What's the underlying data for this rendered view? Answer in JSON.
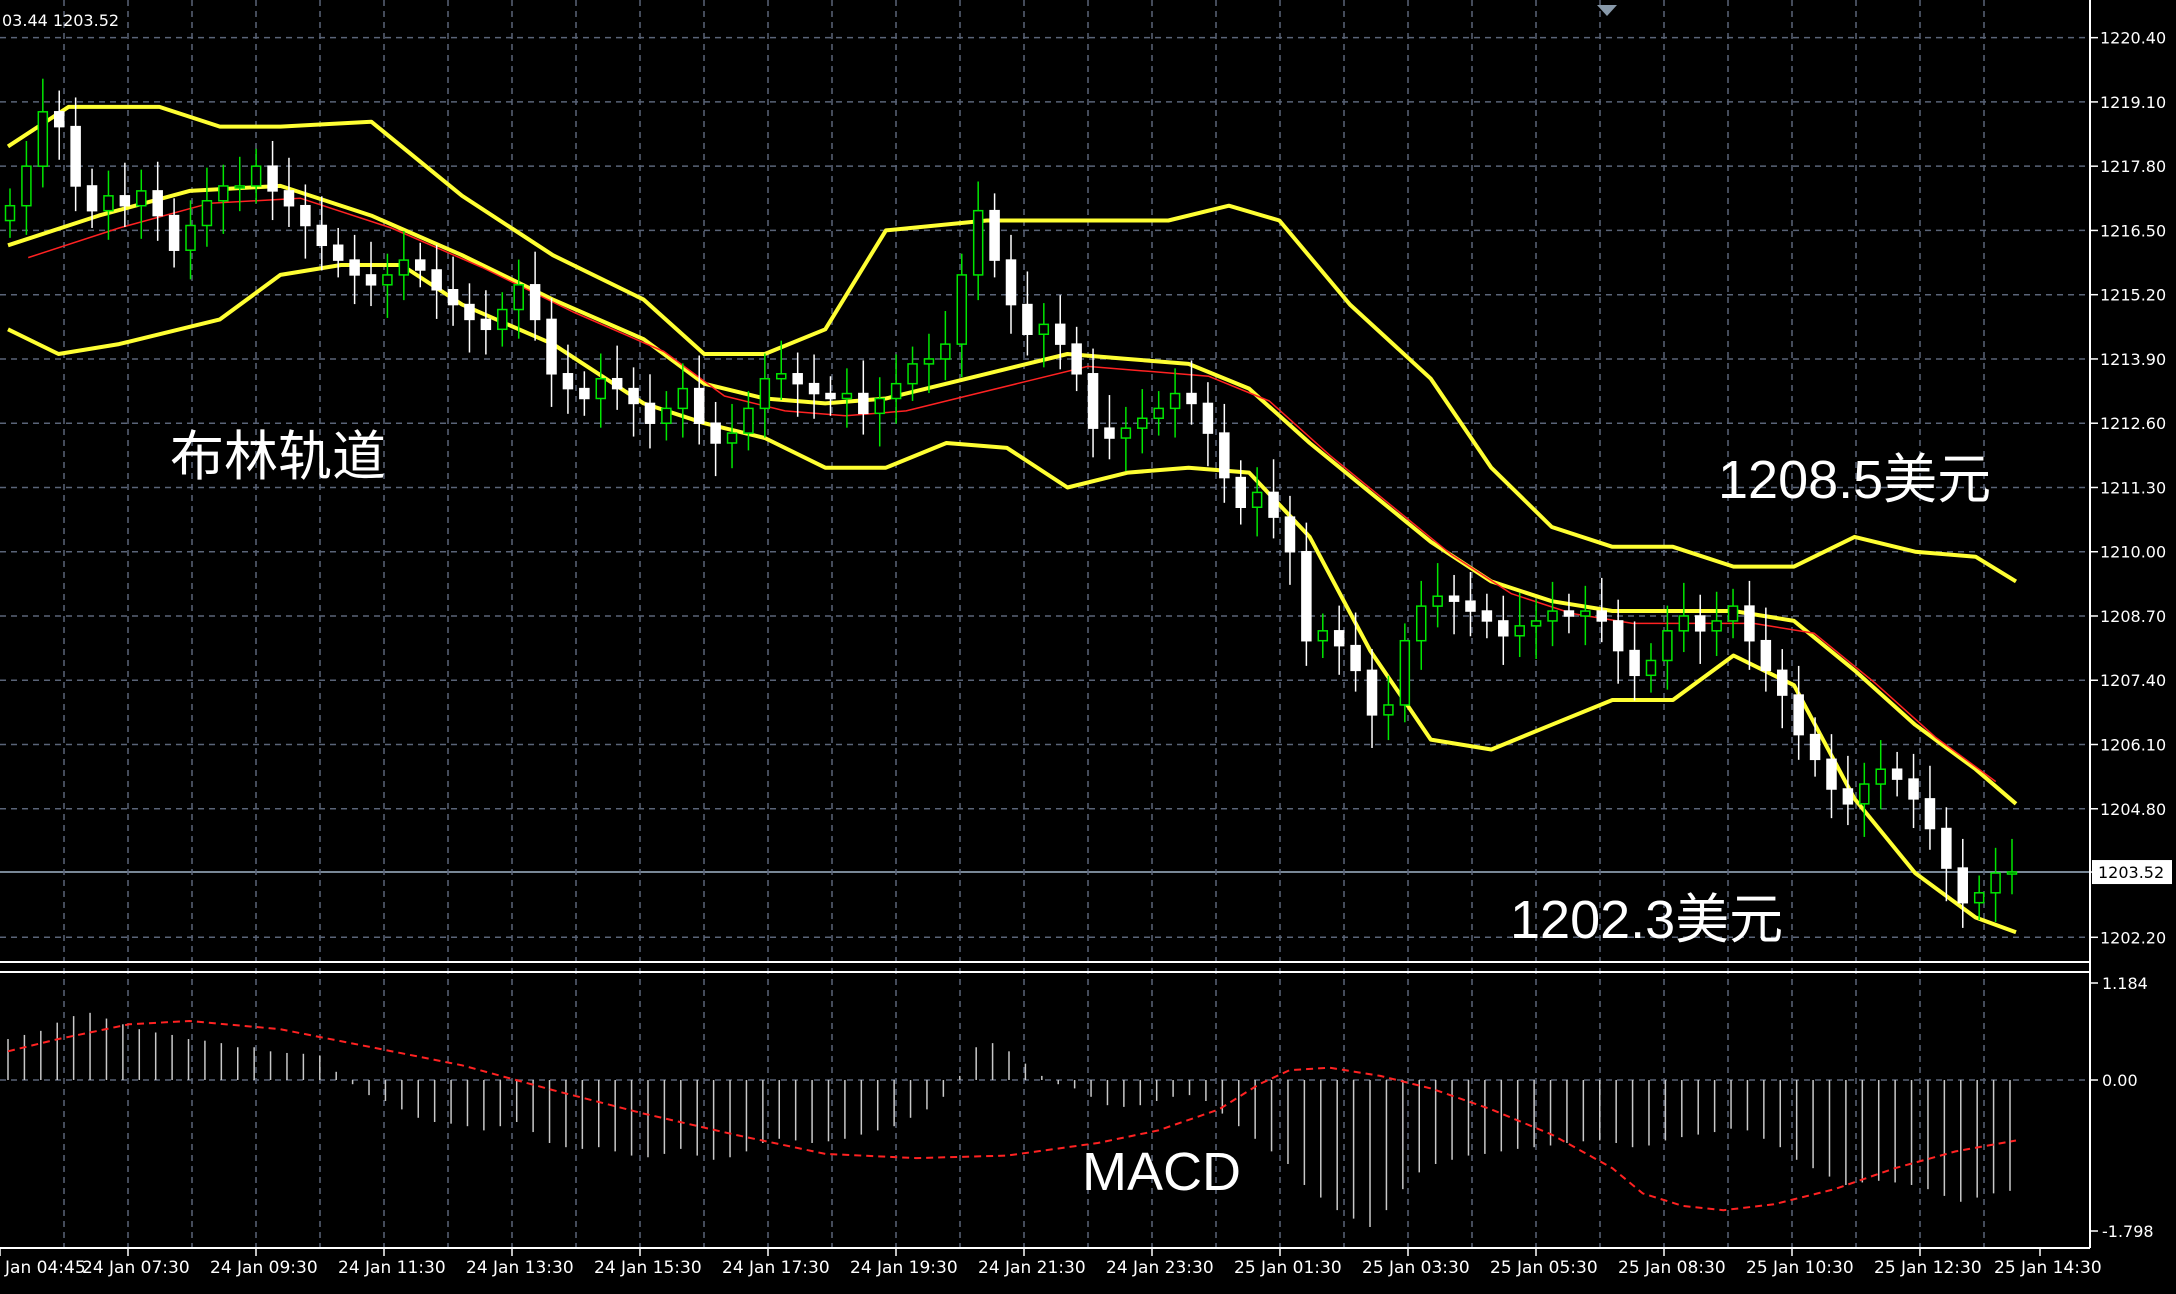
{
  "header": {
    "ohlc_text": "03.44 1203.52"
  },
  "annotations": {
    "bollinger_label": "布林轨道",
    "upper_price_label": "1208.5美元",
    "lower_price_label": "1202.3美元",
    "macd_label": "MACD"
  },
  "colors": {
    "background": "#000000",
    "grid": "#5a6478",
    "axis": "#ffffff",
    "bull_candle": "#00e600",
    "bear_candle": "#ffffff",
    "bollinger": "#ffff33",
    "moving_average": "#ff2222",
    "macd_histogram": "#c8c8c8",
    "macd_signal": "#ff2222",
    "current_price_line": "#a0b4c8"
  },
  "chart_data": [
    {
      "type": "candlestick",
      "symbol_panel": "price",
      "ylim": [
        1201.7,
        1221.0
      ],
      "y_ticks": [
        "1220.40",
        "1219.10",
        "1217.80",
        "1216.50",
        "1215.20",
        "1213.90",
        "1212.60",
        "1211.30",
        "1210.00",
        "1208.70",
        "1207.40",
        "1206.10",
        "1204.80",
        "1203.52",
        "1202.20"
      ],
      "x_ticks": [
        "24 Jan 04:45",
        "24 Jan 07:30",
        "24 Jan 09:30",
        "24 Jan 11:30",
        "24 Jan 13:30",
        "24 Jan 15:30",
        "24 Jan 17:30",
        "24 Jan 19:30",
        "24 Jan 21:30",
        "24 Jan 23:30",
        "25 Jan 01:30",
        "25 Jan 03:30",
        "25 Jan 05:30",
        "25 Jan 08:30",
        "25 Jan 10:30",
        "25 Jan 12:30",
        "25 Jan 14:30"
      ],
      "current_price": 1203.52,
      "closes": [
        1217.0,
        1217.8,
        1218.9,
        1218.6,
        1217.4,
        1216.9,
        1217.2,
        1217.0,
        1217.3,
        1216.8,
        1216.1,
        1216.6,
        1217.1,
        1217.4,
        1217.4,
        1217.8,
        1217.3,
        1217.0,
        1216.6,
        1216.2,
        1215.9,
        1215.6,
        1215.4,
        1215.6,
        1215.9,
        1215.7,
        1215.3,
        1215.0,
        1214.7,
        1214.5,
        1214.9,
        1215.4,
        1214.7,
        1213.6,
        1213.3,
        1213.1,
        1213.5,
        1213.3,
        1213.0,
        1212.6,
        1212.9,
        1213.3,
        1212.6,
        1212.2,
        1212.4,
        1212.9,
        1213.5,
        1213.6,
        1213.4,
        1213.2,
        1213.1,
        1213.2,
        1212.8,
        1213.1,
        1213.4,
        1213.8,
        1213.9,
        1214.2,
        1215.6,
        1216.9,
        1215.9,
        1215.0,
        1214.4,
        1214.6,
        1214.2,
        1213.6,
        1212.5,
        1212.3,
        1212.5,
        1212.7,
        1212.9,
        1213.2,
        1213.0,
        1212.4,
        1211.5,
        1210.9,
        1211.2,
        1210.7,
        1210.0,
        1208.2,
        1208.4,
        1208.1,
        1207.6,
        1206.7,
        1206.9,
        1208.2,
        1208.9,
        1209.1,
        1209.0,
        1208.8,
        1208.6,
        1208.3,
        1208.5,
        1208.6,
        1208.8,
        1208.7,
        1208.8,
        1208.6,
        1208.0,
        1207.5,
        1207.8,
        1208.4,
        1208.7,
        1208.4,
        1208.6,
        1208.9,
        1208.2,
        1207.6,
        1207.1,
        1206.3,
        1205.8,
        1205.2,
        1204.9,
        1205.3,
        1205.6,
        1205.4,
        1205.0,
        1204.4,
        1203.6,
        1202.9,
        1203.1,
        1203.5,
        1203.52
      ],
      "bollinger_upper": [
        [
          0,
          1218.2
        ],
        [
          6,
          1219.0
        ],
        [
          15,
          1219.0
        ],
        [
          21,
          1218.6
        ],
        [
          27,
          1218.6
        ],
        [
          36,
          1218.7
        ],
        [
          45,
          1217.2
        ],
        [
          54,
          1216.0
        ],
        [
          63,
          1215.1
        ],
        [
          69,
          1214.0
        ],
        [
          75,
          1214.0
        ],
        [
          81,
          1214.5
        ],
        [
          87,
          1216.5
        ],
        [
          97,
          1216.7
        ],
        [
          115,
          1216.7
        ],
        [
          121,
          1217.0
        ],
        [
          126,
          1216.7
        ],
        [
          133,
          1215.0
        ],
        [
          141,
          1213.5
        ],
        [
          147,
          1211.7
        ],
        [
          153,
          1210.5
        ],
        [
          159,
          1210.1
        ],
        [
          165,
          1210.1
        ],
        [
          171,
          1209.7
        ],
        [
          177,
          1209.7
        ],
        [
          183,
          1210.3
        ],
        [
          189,
          1210.0
        ],
        [
          195,
          1209.9
        ],
        [
          199,
          1209.4
        ]
      ],
      "bollinger_lower": [
        [
          0,
          1214.5
        ],
        [
          5,
          1214.0
        ],
        [
          11,
          1214.2
        ],
        [
          21,
          1214.7
        ],
        [
          27,
          1215.6
        ],
        [
          33,
          1215.8
        ],
        [
          39,
          1215.8
        ],
        [
          45,
          1215.0
        ],
        [
          54,
          1214.2
        ],
        [
          63,
          1213.0
        ],
        [
          69,
          1212.6
        ],
        [
          75,
          1212.3
        ],
        [
          81,
          1211.7
        ],
        [
          87,
          1211.7
        ],
        [
          93,
          1212.2
        ],
        [
          99,
          1212.1
        ],
        [
          105,
          1211.3
        ],
        [
          111,
          1211.6
        ],
        [
          117,
          1211.7
        ],
        [
          123,
          1211.6
        ],
        [
          129,
          1210.3
        ],
        [
          135,
          1208.0
        ],
        [
          141,
          1206.2
        ],
        [
          147,
          1206.0
        ],
        [
          153,
          1206.5
        ],
        [
          159,
          1207.0
        ],
        [
          165,
          1207.0
        ],
        [
          171,
          1207.9
        ],
        [
          177,
          1207.3
        ],
        [
          183,
          1205.0
        ],
        [
          189,
          1203.5
        ],
        [
          195,
          1202.6
        ],
        [
          199,
          1202.3
        ]
      ],
      "bollinger_middle": [
        [
          0,
          1216.2
        ],
        [
          9,
          1216.8
        ],
        [
          18,
          1217.3
        ],
        [
          27,
          1217.4
        ],
        [
          36,
          1216.8
        ],
        [
          45,
          1216.0
        ],
        [
          54,
          1215.1
        ],
        [
          63,
          1214.3
        ],
        [
          69,
          1213.4
        ],
        [
          75,
          1213.1
        ],
        [
          81,
          1213.0
        ],
        [
          87,
          1213.1
        ],
        [
          93,
          1213.4
        ],
        [
          99,
          1213.7
        ],
        [
          105,
          1214.0
        ],
        [
          111,
          1213.9
        ],
        [
          117,
          1213.8
        ],
        [
          123,
          1213.3
        ],
        [
          129,
          1212.2
        ],
        [
          135,
          1211.2
        ],
        [
          141,
          1210.2
        ],
        [
          147,
          1209.4
        ],
        [
          153,
          1209.0
        ],
        [
          159,
          1208.8
        ],
        [
          165,
          1208.8
        ],
        [
          171,
          1208.8
        ],
        [
          177,
          1208.6
        ],
        [
          183,
          1207.6
        ],
        [
          189,
          1206.5
        ],
        [
          195,
          1205.6
        ],
        [
          199,
          1204.9
        ]
      ]
    },
    {
      "type": "macd",
      "symbol_panel": "oscillator",
      "ylim": [
        -1.798,
        1.184
      ],
      "y_ticks": [
        "1.184",
        "0.00",
        "-1.798"
      ],
      "histogram": [
        0.5,
        0.55,
        0.6,
        0.7,
        0.78,
        0.82,
        0.75,
        0.68,
        0.62,
        0.58,
        0.55,
        0.5,
        0.48,
        0.45,
        0.4,
        0.4,
        0.35,
        0.33,
        0.32,
        0.3,
        0.1,
        -0.05,
        -0.18,
        -0.25,
        -0.35,
        -0.45,
        -0.5,
        -0.52,
        -0.55,
        -0.6,
        -0.55,
        -0.5,
        -0.62,
        -0.75,
        -0.8,
        -0.82,
        -0.8,
        -0.85,
        -0.9,
        -0.92,
        -0.88,
        -0.82,
        -0.9,
        -0.95,
        -0.92,
        -0.85,
        -0.75,
        -0.7,
        -0.72,
        -0.75,
        -0.73,
        -0.7,
        -0.65,
        -0.6,
        -0.55,
        -0.45,
        -0.35,
        -0.2,
        0.05,
        0.4,
        0.45,
        0.35,
        0.2,
        0.05,
        -0.05,
        -0.1,
        -0.2,
        -0.3,
        -0.32,
        -0.3,
        -0.25,
        -0.2,
        -0.18,
        -0.25,
        -0.4,
        -0.55,
        -0.7,
        -0.85,
        -1.0,
        -1.25,
        -1.4,
        -1.55,
        -1.65,
        -1.75,
        -1.55,
        -1.3,
        -1.1,
        -1.0,
        -0.95,
        -0.9,
        -0.88,
        -0.85,
        -0.82,
        -0.8,
        -0.78,
        -0.75,
        -0.73,
        -0.72,
        -0.75,
        -0.8,
        -0.78,
        -0.72,
        -0.68,
        -0.65,
        -0.62,
        -0.58,
        -0.6,
        -0.7,
        -0.8,
        -0.95,
        -1.05,
        -1.15,
        -1.25,
        -1.22,
        -1.2,
        -1.22,
        -1.25,
        -1.3,
        -1.38,
        -1.45,
        -1.4,
        -1.35,
        -1.32
      ],
      "signal": [
        [
          0,
          0.35
        ],
        [
          5,
          0.5
        ],
        [
          12,
          0.68
        ],
        [
          18,
          0.72
        ],
        [
          27,
          0.62
        ],
        [
          36,
          0.4
        ],
        [
          45,
          0.18
        ],
        [
          54,
          -0.12
        ],
        [
          63,
          -0.4
        ],
        [
          72,
          -0.65
        ],
        [
          81,
          -0.88
        ],
        [
          90,
          -0.93
        ],
        [
          99,
          -0.9
        ],
        [
          108,
          -0.75
        ],
        [
          114,
          -0.6
        ],
        [
          120,
          -0.35
        ],
        [
          124,
          -0.05
        ],
        [
          127,
          0.12
        ],
        [
          131,
          0.15
        ],
        [
          136,
          0.05
        ],
        [
          141,
          -0.1
        ],
        [
          147,
          -0.35
        ],
        [
          153,
          -0.65
        ],
        [
          159,
          -1.05
        ],
        [
          162,
          -1.35
        ],
        [
          166,
          -1.5
        ],
        [
          170,
          -1.55
        ],
        [
          175,
          -1.48
        ],
        [
          181,
          -1.3
        ],
        [
          187,
          -1.05
        ],
        [
          193,
          -0.85
        ],
        [
          199,
          -0.72
        ]
      ],
      "signal_scale_note": ""
    }
  ]
}
